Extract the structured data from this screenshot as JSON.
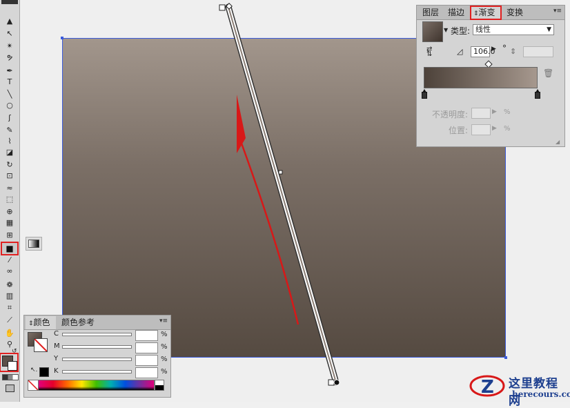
{
  "gradient_panel": {
    "tabs": [
      {
        "label": "图层"
      },
      {
        "label": "描边"
      },
      {
        "label": "渐变",
        "prefix": "⇕"
      },
      {
        "label": "变换"
      }
    ],
    "type_label": "类型:",
    "type_value": "线性",
    "angle_value": "106.0",
    "degree_symbol": "°",
    "opacity_label": "不透明度:",
    "location_label": "位置:",
    "percent": "%"
  },
  "color_panel": {
    "tabs": [
      {
        "label": "颜色",
        "prefix": "⇕"
      },
      {
        "label": "颜色参考"
      }
    ],
    "channels": [
      {
        "label": "C",
        "unit": "%"
      },
      {
        "label": "M",
        "unit": "%"
      },
      {
        "label": "Y",
        "unit": "%"
      },
      {
        "label": "K",
        "unit": "%"
      }
    ]
  },
  "toolbar": {
    "icons": [
      "selection-tool-icon",
      "direct-selection-tool-icon",
      "magic-wand-icon",
      "lasso-icon",
      "pen-tool-icon",
      "type-tool-icon",
      "line-tool-icon",
      "ellipse-tool-icon",
      "paintbrush-icon",
      "pencil-icon",
      "blob-brush-icon",
      "eraser-icon",
      "rotate-icon",
      "scale-icon",
      "warp-icon",
      "free-transform-icon",
      "shape-builder-icon",
      "perspective-grid-icon",
      "mesh-icon",
      "gradient-tool-icon",
      "eyedropper-icon",
      "blend-icon",
      "symbol-sprayer-icon",
      "column-graph-icon",
      "artboard-icon",
      "slice-icon",
      "hand-icon",
      "zoom-icon"
    ]
  },
  "watermark": {
    "title": "这里教程网",
    "url": "herecours.com",
    "accent": "#1d3f8f"
  },
  "colors": {
    "highlight": "#e02020",
    "selection": "#3b5bdb",
    "gradient_start": "#4d423a",
    "gradient_end": "#a6988e"
  }
}
